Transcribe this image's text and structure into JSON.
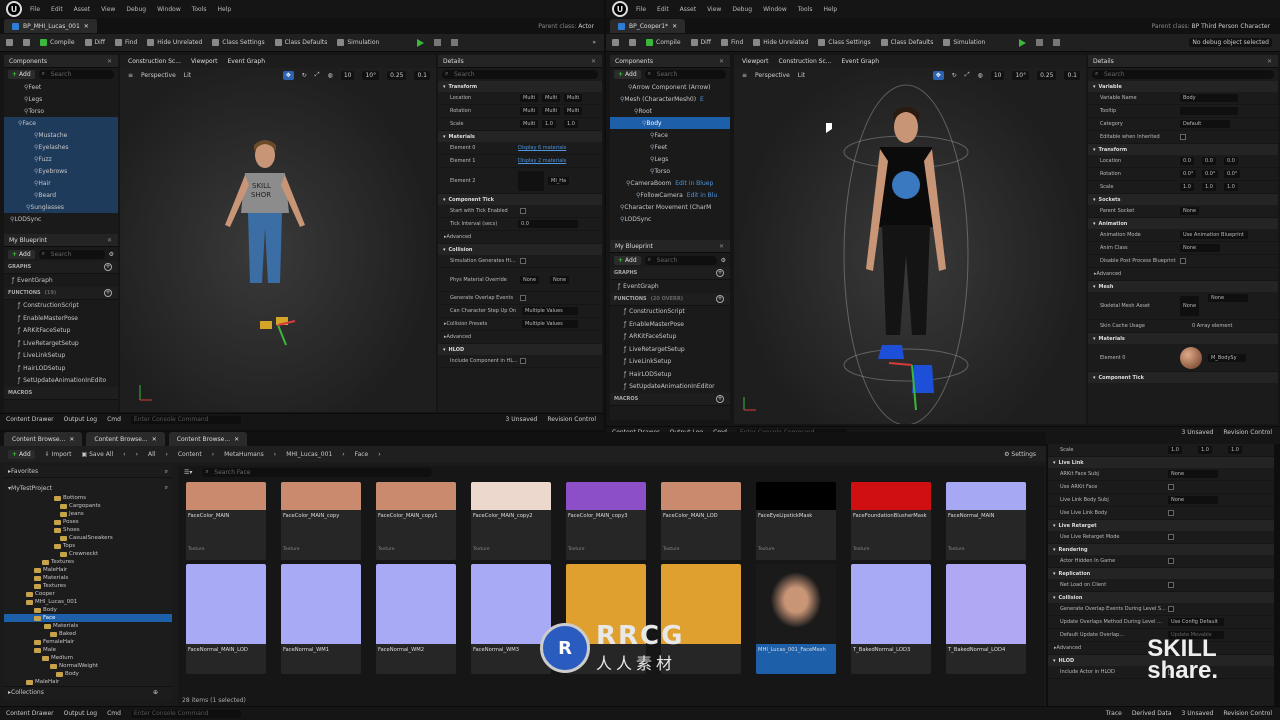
{
  "left": {
    "title": "BP_MHI_Lucas_001",
    "parent_label": "Parent class:",
    "parent_value": "Actor",
    "menu": [
      "File",
      "Edit",
      "Asset",
      "View",
      "Debug",
      "Window",
      "Tools",
      "Help"
    ],
    "toolbar": [
      "Compile",
      "Diff",
      "Find",
      "Hide Unrelated",
      "Class Settings",
      "Class Defaults",
      "Simulation"
    ],
    "components_tab": "Components",
    "construction_tab": "Construction Sc...",
    "viewport_tab": "Viewport",
    "eventgraph_tab": "Event Graph",
    "details_tab": "Details",
    "add": "Add",
    "search": "Search",
    "tree": [
      {
        "label": "Feet",
        "indent": 20
      },
      {
        "label": "Legs",
        "indent": 20
      },
      {
        "label": "Torso",
        "indent": 20
      },
      {
        "label": "Face",
        "indent": 14
      },
      {
        "label": "Mustache",
        "indent": 30
      },
      {
        "label": "Eyelashes",
        "indent": 30
      },
      {
        "label": "Fuzz",
        "indent": 30
      },
      {
        "label": "Eyebrows",
        "indent": 30
      },
      {
        "label": "Hair",
        "indent": 30
      },
      {
        "label": "Beard",
        "indent": 30
      },
      {
        "label": "Sunglasses",
        "indent": 22
      },
      {
        "label": "LODSync",
        "indent": 6
      }
    ],
    "my_blueprint": "My Blueprint",
    "graphs": "GRAPHS",
    "event_graph": "EventGraph",
    "functions": "FUNCTIONS",
    "functions_count": "(19)",
    "function_list": [
      "ConstructionScript",
      "EnableMasterPose",
      "ARKitFaceSetup",
      "LiveRetargetSetup",
      "LiveLinkSetup",
      "HairLODSetup",
      "SetUpdateAnimationInEdito"
    ],
    "macros": "MACROS",
    "perspective": "Perspective",
    "lit": "Lit",
    "snap": [
      "10",
      "10°",
      "0.25",
      "0.1"
    ],
    "details": {
      "transform": "Transform",
      "location": "Location",
      "rotation": "Rotation",
      "scale": "Scale",
      "multi": "Multi",
      "one": "1.0",
      "materials": "Materials",
      "element0": "Element 0",
      "element1": "Element 1",
      "element2": "Element 2",
      "display6": "Display 6 materials",
      "display2": "Display 2 materials",
      "mi": "MI_Ha",
      "component_tick": "Component Tick",
      "start_tick": "Start with Tick Enabled",
      "tick_interval": "Tick Interval (secs)",
      "zero": "0.0",
      "advanced": "Advanced",
      "collision": "Collision",
      "sim_hit": "Simulation Generates Hi...",
      "phys_mat": "Phys Material Override",
      "none": "None",
      "gen_overlap": "Generate Overlap Events",
      "can_step": "Can Character Step Up On",
      "multiple": "Multiple Values",
      "collision_presets": "Collision Presets",
      "hlod": "HLOD",
      "include_hlod": "Include Component in HL..."
    },
    "status": [
      "Content Drawer",
      "Output Log",
      "Cmd",
      "Enter Console Command",
      "3 Unsaved",
      "Revision Control"
    ]
  },
  "right": {
    "title": "BP_Cooper1*",
    "parent_label": "Parent class:",
    "parent_value": "BP Third Person Character",
    "debug": "No debug object selected",
    "menu": [
      "File",
      "Edit",
      "Asset",
      "View",
      "Debug",
      "Window",
      "Tools",
      "Help"
    ],
    "toolbar": [
      "Compile",
      "Diff",
      "Find",
      "Hide Unrelated",
      "Class Settings",
      "Class Defaults",
      "Simulation"
    ],
    "components_tab": "Components",
    "viewport_tab": "Viewport",
    "construction_tab": "Construction Sc...",
    "eventgraph_tab": "Event Graph",
    "details_tab": "Details",
    "add": "Add",
    "search": "Search",
    "tree": [
      {
        "label": "Arrow Component (Arrow)",
        "indent": 18,
        "sel": false
      },
      {
        "label": "Mesh (CharacterMesh0)",
        "indent": 10,
        "sel": false,
        "extra": "E"
      },
      {
        "label": "Root",
        "indent": 24,
        "sel": false
      },
      {
        "label": "Body",
        "indent": 32,
        "sel": true
      },
      {
        "label": "Face",
        "indent": 40,
        "sel": false
      },
      {
        "label": "Feet",
        "indent": 40,
        "sel": false
      },
      {
        "label": "Legs",
        "indent": 40,
        "sel": false
      },
      {
        "label": "Torso",
        "indent": 40,
        "sel": false
      },
      {
        "label": "CameraBoom",
        "indent": 16,
        "sel": false,
        "extra": "Edit in Bluep"
      },
      {
        "label": "FollowCamera",
        "indent": 26,
        "sel": false,
        "extra": "Edit in Blu"
      },
      {
        "label": "Character Movement (CharM",
        "indent": 10,
        "sel": false
      },
      {
        "label": "LODSync",
        "indent": 10,
        "sel": false
      }
    ],
    "my_blueprint": "My Blueprint",
    "graphs": "GRAPHS",
    "event_graph": "EventGraph",
    "functions": "FUNCTIONS",
    "functions_count": "(20 OVERR)",
    "function_list": [
      "ConstructionScript",
      "EnableMasterPose",
      "ARKitFaceSetup",
      "LiveRetargetSetup",
      "LiveLinkSetup",
      "HairLODSetup",
      "SetUpdateAnimationInEditor"
    ],
    "macros": "MACROS",
    "perspective": "Perspective",
    "lit": "Lit",
    "snap": [
      "10",
      "10°",
      "0.25",
      "0.1"
    ],
    "details": {
      "variable": "Variable",
      "variable_name": "Variable Name",
      "variable_name_val": "Body",
      "tooltip": "Tooltip",
      "category": "Category",
      "category_val": "Default",
      "editable_inherited": "Editable when Inherited",
      "transform": "Transform",
      "location": "Location",
      "rotation": "Rotation",
      "scale": "Scale",
      "zero": "0.0",
      "zero_deg": "0.0°",
      "one": "1.0",
      "sockets": "Sockets",
      "parent_socket": "Parent Socket",
      "none": "None",
      "animation": "Animation",
      "animation_mode": "Animation Mode",
      "animation_mode_val": "Use Animation Blueprint",
      "anim_class": "Anim Class",
      "disable_post": "Disable Post Process Blueprint",
      "advanced": "Advanced",
      "mesh": "Mesh",
      "skeletal_mesh": "Skeletal Mesh Asset",
      "skin_cache": "Skin Cache Usage",
      "array_elem": "0 Array element",
      "materials": "Materials",
      "element0": "Element 0",
      "mat_val": "M_BodySy",
      "component_tick": "Component Tick",
      "live_link": "Live Link",
      "arkit_face_subj": "ARKit Face Subj",
      "use_arkit_face": "Use ARKit Face",
      "live_link_body_subj": "Live Link Body Subj",
      "use_live_link_body": "Use Live Link Body",
      "live_retarget": "Live Retarget",
      "use_live_retarget": "Use Live Retarget Mode",
      "rendering": "Rendering",
      "actor_hidden": "Actor Hidden In Game",
      "replication": "Replication",
      "net_load": "Net Load on Client",
      "collision": "Collision",
      "gen_overlap_level": "Generate Overlap Events During Level S...",
      "update_overlaps": "Update Overlaps Method During Level ...",
      "use_config": "Use Config Default",
      "default_update": "Default Update Overlap...",
      "only_movable": "Update Movable",
      "advanced2": "Advanced",
      "hlod": "HLOD",
      "include_actor_hlod": "Include Actor in HLOD"
    },
    "status": [
      "Content Drawer",
      "Output Log",
      "Cmd",
      "Enter Console Command",
      "3 Unsaved",
      "Revision Control"
    ]
  },
  "content": {
    "tabs": [
      "Content Browse...",
      "Content Browse...",
      "Content Browse..."
    ],
    "add": "Add",
    "import": "Import",
    "save_all": "Save All",
    "path": [
      "All",
      "Content",
      "MetaHumans",
      "MHI_Lucas_001",
      "Face"
    ],
    "settings": "Settings",
    "favorites": "Favorites",
    "project": "MyTestProject",
    "search_face": "Search Face",
    "folders": [
      {
        "label": "Bottoms",
        "indent": 50
      },
      {
        "label": "Cargopants",
        "indent": 56
      },
      {
        "label": "Jeans",
        "indent": 56
      },
      {
        "label": "Poses",
        "indent": 50
      },
      {
        "label": "Shoes",
        "indent": 50
      },
      {
        "label": "CasualSneakers",
        "indent": 56
      },
      {
        "label": "Tops",
        "indent": 50
      },
      {
        "label": "Crewneckt",
        "indent": 56
      },
      {
        "label": "Textures",
        "indent": 38
      },
      {
        "label": "MaleHair",
        "indent": 30
      },
      {
        "label": "Materials",
        "indent": 30
      },
      {
        "label": "Textures",
        "indent": 30
      },
      {
        "label": "Cooper",
        "indent": 22
      },
      {
        "label": "MHI_Lucas_001",
        "indent": 22
      },
      {
        "label": "Body",
        "indent": 30
      },
      {
        "label": "Face",
        "indent": 30,
        "sel": true
      },
      {
        "label": "Materials",
        "indent": 40
      },
      {
        "label": "Baked",
        "indent": 46
      },
      {
        "label": "FemaleHair",
        "indent": 30
      },
      {
        "label": "Male",
        "indent": 30
      },
      {
        "label": "Medium",
        "indent": 38
      },
      {
        "label": "NormalWeight",
        "indent": 46
      },
      {
        "label": "Body",
        "indent": 52
      },
      {
        "label": "MaleHair",
        "indent": 22
      }
    ],
    "collections": "Collections",
    "count": "28 items (1 selected)",
    "texture": "Texture",
    "row1": [
      {
        "name": "FaceColor_MAIN",
        "color": "#c98a6e"
      },
      {
        "name": "FaceColor_MAIN_copy",
        "color": "#c98a6e"
      },
      {
        "name": "FaceColor_MAIN_copy1",
        "color": "#c98a6e"
      },
      {
        "name": "FaceColor_MAIN_copy2",
        "color": "#ecd8cc"
      },
      {
        "name": "FaceColor_MAIN_copy3",
        "color": "#8c4fc8"
      },
      {
        "name": "FaceColor_MAIN_LOD",
        "color": "#c98a6e"
      },
      {
        "name": "FaceEyeLipstickMask",
        "color": "#000000"
      },
      {
        "name": "FaceFoundationBlusherMask",
        "color": "#d01010"
      },
      {
        "name": "FaceNormal_MAIN",
        "color": "#a6a8f4"
      }
    ],
    "row2": [
      {
        "name": "FaceNormal_MAIN_LOD",
        "color": "#a8aaf6"
      },
      {
        "name": "FaceNormal_WM1",
        "color": "#a8aaf6"
      },
      {
        "name": "FaceNormal_WM2",
        "color": "#a8aaf6"
      },
      {
        "name": "FaceNormal_WM3",
        "color": "#a8aaf6"
      },
      {
        "name": "",
        "color": "#e0a030"
      },
      {
        "name": "",
        "color": "#e0a030"
      },
      {
        "name": "MHI_Lucas_001_FaceMesh",
        "color": "#1a1a1a",
        "sel": true
      },
      {
        "name": "T_BakedNormal_LOD3",
        "color": "#a8aaf6"
      },
      {
        "name": "T_BakedNormal_LOD4",
        "color": "#b0a8f2"
      }
    ],
    "status": [
      "Content Drawer",
      "Output Log",
      "Cmd",
      "Enter Console Command",
      "Trace",
      "Derived Data",
      "3 Unsaved",
      "Revision Control"
    ]
  },
  "watermark": {
    "text1": "RRCG",
    "text2": "人人素材",
    "skill1": "SKILL",
    "skill2": "share."
  },
  "colors": {
    "accent": "#1d5fa8",
    "play": "#3bb83b"
  }
}
